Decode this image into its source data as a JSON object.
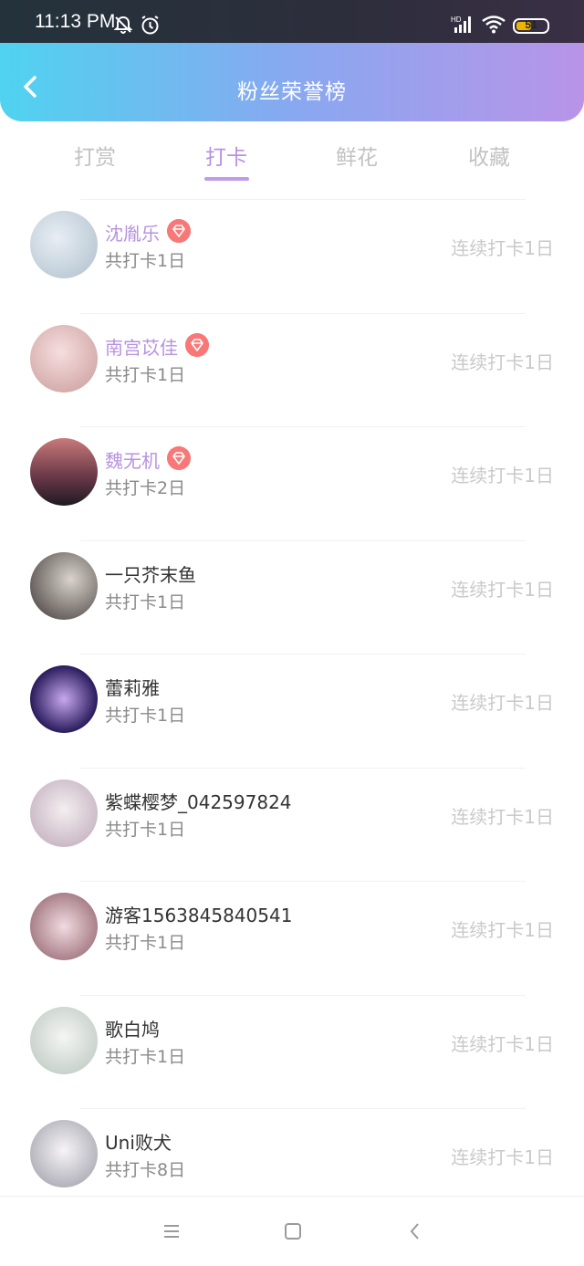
{
  "status_bar": {
    "time": "11:13 PM",
    "battery_level": "51",
    "battery_fraction": 0.51,
    "icons": [
      "bell-off-icon",
      "alarm-icon",
      "hd-signal-icon",
      "wifi-icon",
      "battery-icon"
    ]
  },
  "header": {
    "title": "粉丝荣誉榜",
    "back_icon": "chevron-left-icon",
    "gradient_colors": [
      "#4fd3f0",
      "#b894e8"
    ]
  },
  "tabs": [
    {
      "label": "打赏",
      "active": false
    },
    {
      "label": "打卡",
      "active": true
    },
    {
      "label": "鲜花",
      "active": false
    },
    {
      "label": "收藏",
      "active": false
    }
  ],
  "accent_color": "#b792e0",
  "list": [
    {
      "name": "沈胤乐",
      "vip": true,
      "total": "共打卡1日",
      "streak": "连续打卡1日"
    },
    {
      "name": "南宫苡佳",
      "vip": true,
      "total": "共打卡1日",
      "streak": "连续打卡1日"
    },
    {
      "name": "魏无机",
      "vip": true,
      "total": "共打卡2日",
      "streak": "连续打卡1日"
    },
    {
      "name": "一只芥末鱼",
      "vip": false,
      "total": "共打卡1日",
      "streak": "连续打卡1日"
    },
    {
      "name": "蕾莉雅",
      "vip": false,
      "total": "共打卡1日",
      "streak": "连续打卡1日"
    },
    {
      "name": "紫蝶樱梦_042597824",
      "vip": false,
      "total": "共打卡1日",
      "streak": "连续打卡1日"
    },
    {
      "name": "游客1563845840541",
      "vip": false,
      "total": "共打卡1日",
      "streak": "连续打卡1日"
    },
    {
      "name": "歌白鸠",
      "vip": false,
      "total": "共打卡1日",
      "streak": "连续打卡1日"
    },
    {
      "name": "Uni败犬",
      "vip": false,
      "total": "共打卡8日",
      "streak": "连续打卡1日"
    }
  ],
  "nav": {
    "icons": [
      "menu-icon",
      "home-icon",
      "back-icon"
    ]
  }
}
